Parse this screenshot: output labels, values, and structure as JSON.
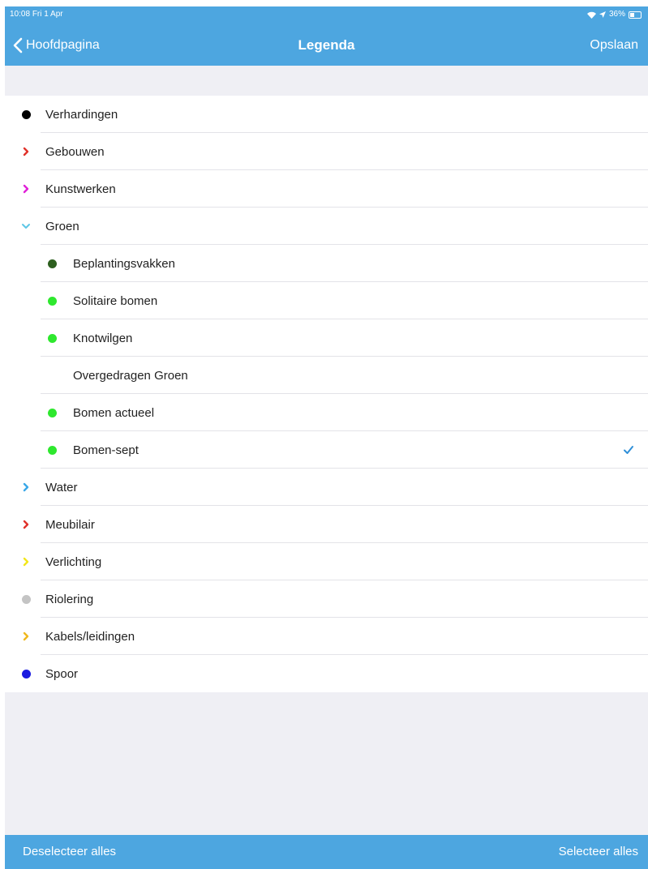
{
  "status_bar": {
    "time": "10:08",
    "date": "Fri 1 Apr",
    "battery": "36%"
  },
  "nav": {
    "back_label": "Hoofdpagina",
    "title": "Legenda",
    "save_label": "Opslaan"
  },
  "legend_items": [
    {
      "label": "Verhardingen",
      "marker": "dot",
      "color": "#000000",
      "level": 0,
      "checked": false
    },
    {
      "label": "Gebouwen",
      "marker": "chevron-right",
      "color": "#e0322a",
      "level": 0,
      "checked": false
    },
    {
      "label": "Kunstwerken",
      "marker": "chevron-right",
      "color": "#e020d8",
      "level": 0,
      "checked": false
    },
    {
      "label": "Groen",
      "marker": "chevron-down",
      "color": "#5ec7e6",
      "level": 0,
      "checked": false
    },
    {
      "label": "Beplantingsvakken",
      "marker": "dot",
      "color": "#2d5f1e",
      "level": 1,
      "checked": false
    },
    {
      "label": "Solitaire bomen",
      "marker": "dot",
      "color": "#2ee82e",
      "level": 1,
      "checked": false
    },
    {
      "label": "Knotwilgen",
      "marker": "dot",
      "color": "#2ee82e",
      "level": 1,
      "checked": false
    },
    {
      "label": "Overgedragen Groen",
      "marker": "none",
      "color": "",
      "level": 1,
      "checked": false
    },
    {
      "label": "Bomen actueel",
      "marker": "dot",
      "color": "#2ee82e",
      "level": 1,
      "checked": false
    },
    {
      "label": "Bomen-sept",
      "marker": "dot",
      "color": "#2ee82e",
      "level": 1,
      "checked": true
    },
    {
      "label": "Water",
      "marker": "chevron-right",
      "color": "#3aa8e8",
      "level": 0,
      "checked": false
    },
    {
      "label": "Meubilair",
      "marker": "chevron-right",
      "color": "#e0322a",
      "level": 0,
      "checked": false
    },
    {
      "label": "Verlichting",
      "marker": "chevron-right",
      "color": "#f2e61a",
      "level": 0,
      "checked": false
    },
    {
      "label": "Riolering",
      "marker": "dot",
      "color": "#c4c4c4",
      "level": 0,
      "checked": false
    },
    {
      "label": "Kabels/leidingen",
      "marker": "chevron-right",
      "color": "#f0b81e",
      "level": 0,
      "checked": false
    },
    {
      "label": "Spoor",
      "marker": "dot",
      "color": "#1a1ae0",
      "level": 0,
      "checked": false
    }
  ],
  "footer": {
    "deselect_label": "Deselecteer alles",
    "select_label": "Selecteer alles"
  },
  "colors": {
    "accent": "#4da6e0",
    "check": "#2f8fd8"
  }
}
